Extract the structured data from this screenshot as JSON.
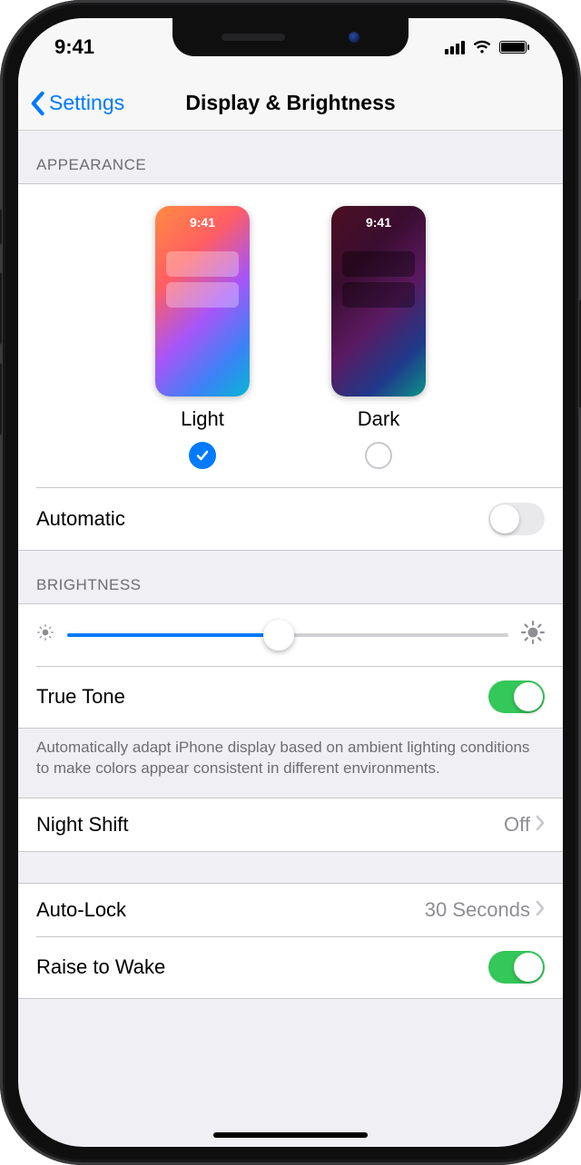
{
  "status": {
    "time": "9:41"
  },
  "nav": {
    "back": "Settings",
    "title": "Display & Brightness"
  },
  "appearance": {
    "header": "APPEARANCE",
    "options": [
      {
        "label": "Light",
        "preview_time": "9:41",
        "selected": true
      },
      {
        "label": "Dark",
        "preview_time": "9:41",
        "selected": false
      }
    ],
    "automatic": {
      "label": "Automatic",
      "value": false
    }
  },
  "brightness": {
    "header": "BRIGHTNESS",
    "level_percent": 48,
    "truetone": {
      "label": "True Tone",
      "value": true,
      "description": "Automatically adapt iPhone display based on ambient lighting conditions to make colors appear consistent in different environments."
    }
  },
  "night_shift": {
    "label": "Night Shift",
    "value": "Off"
  },
  "auto_lock": {
    "label": "Auto-Lock",
    "value": "30 Seconds"
  },
  "raise_to_wake": {
    "label": "Raise to Wake",
    "value": true
  }
}
